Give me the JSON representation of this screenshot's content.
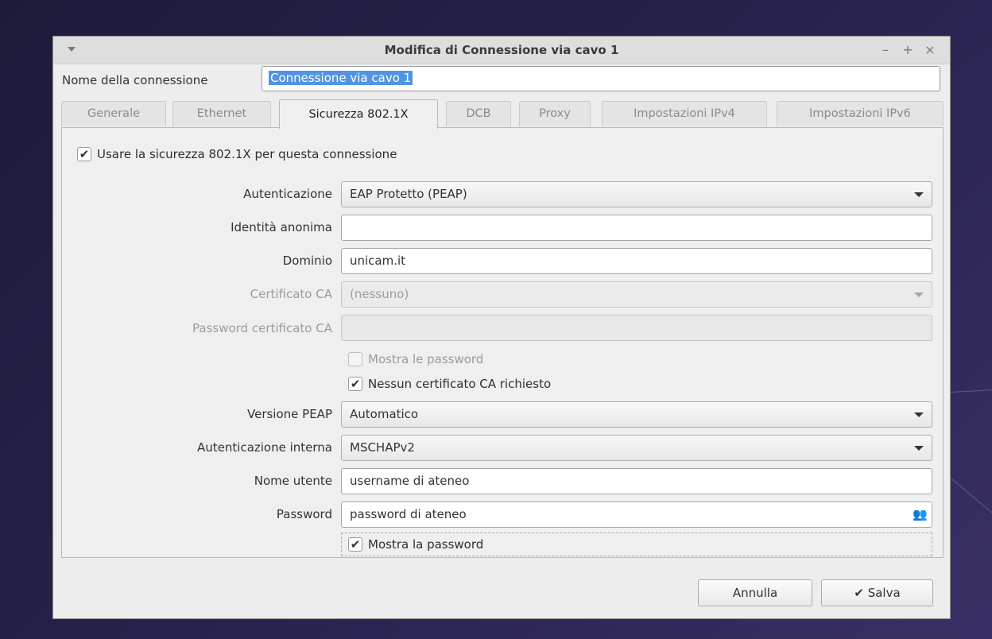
{
  "window": {
    "title": "Modifica di Connessione via cavo 1",
    "minimize": "–",
    "maximize": "+",
    "close": "×"
  },
  "connection_name": {
    "label": "Nome della connessione",
    "value": "Connessione via cavo 1"
  },
  "tabs": [
    {
      "label": "Generale",
      "active": false
    },
    {
      "label": "Ethernet",
      "active": false
    },
    {
      "label": "Sicurezza 802.1X",
      "active": true
    },
    {
      "label": "DCB",
      "active": false
    },
    {
      "label": "Proxy",
      "active": false
    },
    {
      "label": "Impostazioni IPv4",
      "active": false
    },
    {
      "label": "Impostazioni IPv6",
      "active": false
    }
  ],
  "security": {
    "use_8021x": {
      "label": "Usare la sicurezza 802.1X per questa connessione",
      "checked": true
    },
    "authentication": {
      "label": "Autenticazione",
      "value": "EAP Protetto (PEAP)"
    },
    "anonymous_identity": {
      "label": "Identità anonima",
      "value": ""
    },
    "domain": {
      "label": "Dominio",
      "value": "unicam.it"
    },
    "ca_certificate": {
      "label": "Certificato CA",
      "value": "(nessuno)",
      "disabled": true
    },
    "ca_cert_password": {
      "label": "Password certificato CA",
      "value": "",
      "disabled": true
    },
    "show_passwords": {
      "label": "Mostra le password",
      "checked": false,
      "disabled": true
    },
    "no_ca_required": {
      "label": "Nessun certificato CA richiesto",
      "checked": true
    },
    "peap_version": {
      "label": "Versione PEAP",
      "value": "Automatico"
    },
    "inner_auth": {
      "label": "Autenticazione interna",
      "value": "MSCHAPv2"
    },
    "username": {
      "label": "Nome utente",
      "value": "username di ateneo"
    },
    "password": {
      "label": "Password",
      "value": "password di ateneo"
    },
    "show_password": {
      "label": "Mostra la password",
      "checked": true
    }
  },
  "buttons": {
    "cancel": "Annulla",
    "save": "Salva"
  },
  "icons": {
    "check": "✔",
    "users": "👥"
  }
}
